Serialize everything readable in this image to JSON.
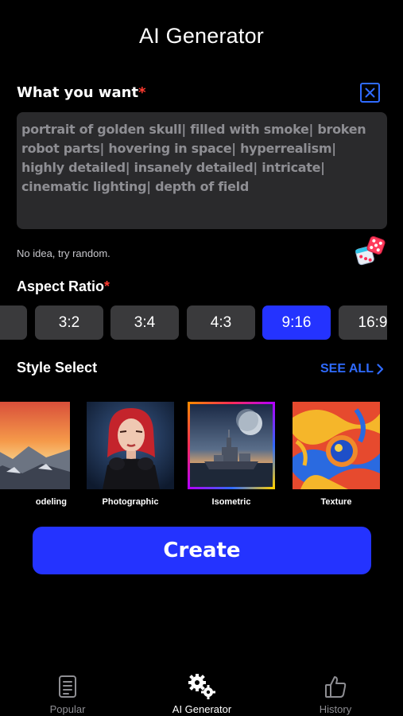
{
  "header": {
    "title": "AI Generator"
  },
  "prompt": {
    "label": "What you want",
    "required_mark": "*",
    "text": "portrait of golden skull| filled with smoke| broken robot parts| hovering in space| hyperrealism| highly detailed| insanely detailed| intricate| cinematic lighting| depth of field",
    "random_hint": "No idea, try random."
  },
  "aspect_ratio": {
    "label": "Aspect Ratio",
    "required_mark": "*",
    "options": [
      "",
      "3:2",
      "3:4",
      "4:3",
      "9:16",
      "16:9"
    ],
    "selected": "9:16"
  },
  "styles": {
    "label": "Style Select",
    "see_all": "SEE ALL",
    "items": [
      {
        "name": "odeling"
      },
      {
        "name": "Photographic"
      },
      {
        "name": "Isometric"
      },
      {
        "name": "Texture"
      }
    ],
    "selected": "Isometric"
  },
  "create_label": "Create",
  "tabs": [
    {
      "label": "Popular",
      "icon": "list-icon"
    },
    {
      "label": "AI Generator",
      "icon": "gears-icon"
    },
    {
      "label": "History",
      "icon": "thumbs-up-icon"
    }
  ],
  "active_tab": "AI Generator",
  "colors": {
    "accent": "#2433ff",
    "link": "#2f6bff",
    "required": "#ff3b30",
    "surface": "#2a2a2c",
    "chip": "#3a3a3c"
  }
}
